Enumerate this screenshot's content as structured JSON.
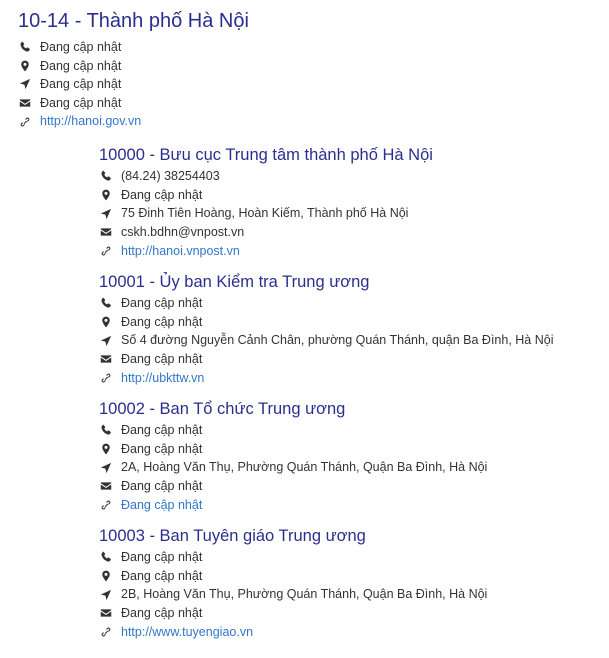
{
  "region": {
    "title": "10-14 - Thành phố Hà Nội",
    "phone": "Đang cập nhật",
    "location": "Đang cập nhật",
    "address": "Đang cập nhật",
    "email": "Đang cập nhật",
    "website": "http://hanoi.gov.vn"
  },
  "offices": [
    {
      "title": "10000 - Bưu cục Trung tâm thành phố Hà Nội",
      "phone": "(84.24) 38254403",
      "location": "Đang cập nhật",
      "address": "75 Đinh Tiên Hoàng, Hoàn Kiếm, Thành phố Hà Nội",
      "email": "cskh.bdhn@vnpost.vn",
      "website": "http://hanoi.vnpost.vn"
    },
    {
      "title": "10001 - Ủy ban Kiểm tra Trung ương",
      "phone": "Đang cập nhật",
      "location": "Đang cập nhật",
      "address": "Số 4 đường Nguyễn Cảnh Chân, phường Quán Thánh, quận Ba Đình, Hà Nội",
      "email": "Đang cập nhật",
      "website": "http://ubkttw.vn"
    },
    {
      "title": "10002 - Ban Tổ chức Trung ương",
      "phone": "Đang cập nhật",
      "location": "Đang cập nhật",
      "address": "2A, Hoàng Văn Thụ, Phường Quán Thánh, Quận Ba Đình, Hà Nội",
      "email": "Đang cập nhật",
      "website": "Đang cập nhật"
    },
    {
      "title": "10003 - Ban Tuyên giáo Trung ương",
      "phone": "Đang cập nhật",
      "location": "Đang cập nhật",
      "address": "2B, Hoàng Văn Thụ, Phường Quán Thánh, Quận Ba Đình, Hà Nội",
      "email": "Đang cập nhật",
      "website": "http://www.tuyengiao.vn"
    }
  ],
  "icons": {
    "phone": "phone-icon",
    "location": "map-marker-icon",
    "address": "location-arrow-icon",
    "email": "envelope-icon",
    "website": "link-icon"
  },
  "colors": {
    "title": "#2a2f8f",
    "link": "#3277c9",
    "text": "#333333"
  }
}
